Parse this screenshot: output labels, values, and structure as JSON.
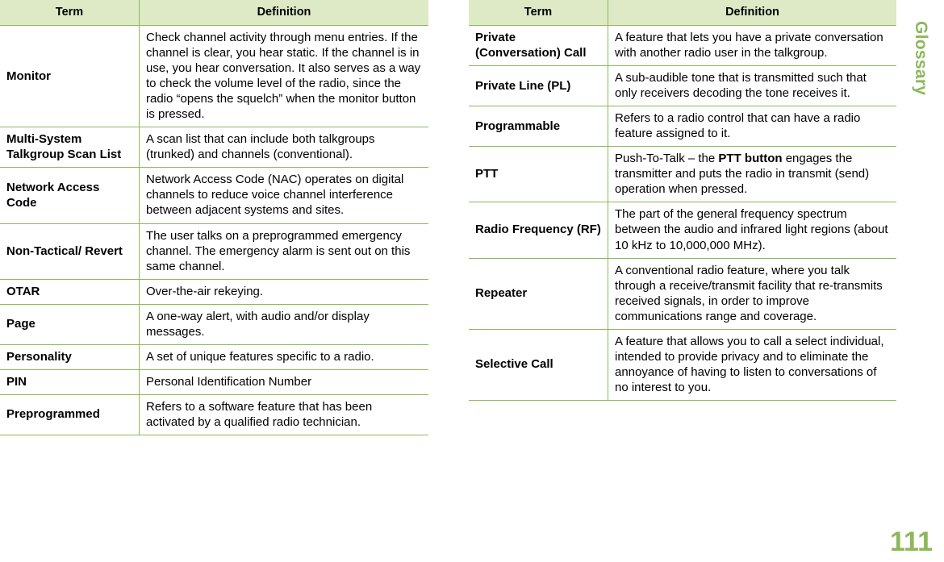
{
  "document": {
    "side_tab_label": "Glossary",
    "page_number": "111",
    "accent_color": "#8cb85a",
    "header_fill": "#dee9c6",
    "border_color": "#8cb85a"
  },
  "left_table": {
    "headers": {
      "term": "Term",
      "definition": "Definition"
    },
    "rows": [
      {
        "term": "Monitor",
        "definition": "Check channel activity through menu entries. If the channel is clear, you hear static. If the channel is in use, you hear conversation. It also serves as a way to check the volume level of the radio, since the radio “opens the squelch” when the monitor button is pressed."
      },
      {
        "term": "Multi-System Talkgroup Scan List",
        "definition": "A scan list that can include both talkgroups (trunked) and channels (conventional)."
      },
      {
        "term": "Network Access Code",
        "definition": "Network Access Code (NAC) operates on digital channels to reduce voice channel interference between adjacent systems and sites."
      },
      {
        "term": "Non-Tactical/ Revert",
        "definition": "The user talks on a preprogrammed emergency channel. The emergency alarm is sent out on this same channel."
      },
      {
        "term": "OTAR",
        "definition": "Over-the-air rekeying."
      },
      {
        "term": "Page",
        "definition": "A one-way alert, with audio and/or display messages."
      },
      {
        "term": "Personality",
        "definition": "A set of unique features specific to a radio."
      },
      {
        "term": "PIN",
        "definition": "Personal Identification Number"
      },
      {
        "term": "Preprogrammed",
        "definition": "Refers to a software feature that has been activated by a qualified radio technician."
      }
    ]
  },
  "right_table": {
    "headers": {
      "term": "Term",
      "definition": "Definition"
    },
    "rows": [
      {
        "term": "Private (Conversation) Call",
        "definition": "A feature that lets you have a private conversation with another radio user in the talkgroup."
      },
      {
        "term": "Private Line (PL)",
        "definition": "A sub-audible tone that is transmitted such that only receivers decoding the tone receives it."
      },
      {
        "term": "Programmable",
        "definition": "Refers to a radio control that can have a radio feature assigned to it."
      },
      {
        "term": "PTT",
        "definition_parts": [
          {
            "text": "Push-To-Talk – the ",
            "bold": false
          },
          {
            "text": "PTT button",
            "bold": true
          },
          {
            "text": " engages the transmitter and puts the radio in transmit (send) operation when pressed.",
            "bold": false
          }
        ],
        "definition": "Push-To-Talk – the PTT button engages the transmitter and puts the radio in transmit (send) operation when pressed."
      },
      {
        "term": "Radio Frequency (RF)",
        "definition": "The part of the general frequency spectrum between the audio and infrared light regions (about 10 kHz to 10,000,000 MHz)."
      },
      {
        "term": "Repeater",
        "definition": "A conventional radio feature, where you talk through a receive/transmit facility that re-transmits received signals, in order to improve communications range and coverage."
      },
      {
        "term": "Selective Call",
        "definition": "A feature that allows you to call a select individual, intended to provide privacy and to eliminate the annoyance of having to listen to conversations of no interest to you."
      }
    ]
  }
}
